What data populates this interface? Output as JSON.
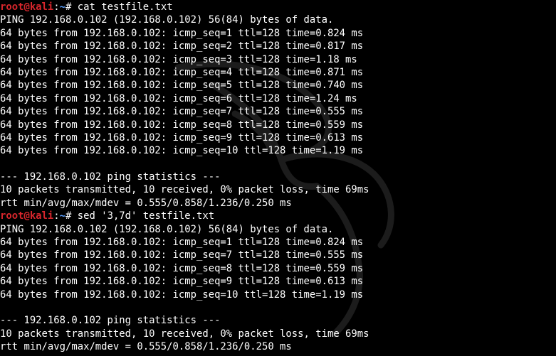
{
  "terminal": {
    "lines": [
      {
        "type": "prompt",
        "user": "root@kali",
        "sep": ":",
        "path": "~",
        "symbol": "# ",
        "command": "cat testfile.txt"
      },
      {
        "type": "text",
        "text": "PING 192.168.0.102 (192.168.0.102) 56(84) bytes of data."
      },
      {
        "type": "text",
        "text": "64 bytes from 192.168.0.102: icmp_seq=1 ttl=128 time=0.824 ms"
      },
      {
        "type": "text",
        "text": "64 bytes from 192.168.0.102: icmp_seq=2 ttl=128 time=0.817 ms"
      },
      {
        "type": "text",
        "text": "64 bytes from 192.168.0.102: icmp_seq=3 ttl=128 time=1.18 ms"
      },
      {
        "type": "text",
        "text": "64 bytes from 192.168.0.102: icmp_seq=4 ttl=128 time=0.871 ms"
      },
      {
        "type": "text",
        "text": "64 bytes from 192.168.0.102: icmp_seq=5 ttl=128 time=0.740 ms"
      },
      {
        "type": "text",
        "text": "64 bytes from 192.168.0.102: icmp_seq=6 ttl=128 time=1.24 ms"
      },
      {
        "type": "text",
        "text": "64 bytes from 192.168.0.102: icmp_seq=7 ttl=128 time=0.555 ms"
      },
      {
        "type": "text",
        "text": "64 bytes from 192.168.0.102: icmp_seq=8 ttl=128 time=0.559 ms"
      },
      {
        "type": "text",
        "text": "64 bytes from 192.168.0.102: icmp_seq=9 ttl=128 time=0.613 ms"
      },
      {
        "type": "text",
        "text": "64 bytes from 192.168.0.102: icmp_seq=10 ttl=128 time=1.19 ms"
      },
      {
        "type": "text",
        "text": ""
      },
      {
        "type": "text",
        "text": "--- 192.168.0.102 ping statistics ---"
      },
      {
        "type": "text",
        "text": "10 packets transmitted, 10 received, 0% packet loss, time 69ms"
      },
      {
        "type": "text",
        "text": "rtt min/avg/max/mdev = 0.555/0.858/1.236/0.250 ms"
      },
      {
        "type": "prompt",
        "user": "root@kali",
        "sep": ":",
        "path": "~",
        "symbol": "# ",
        "command": "sed '3,7d' testfile.txt"
      },
      {
        "type": "text",
        "text": "PING 192.168.0.102 (192.168.0.102) 56(84) bytes of data."
      },
      {
        "type": "text",
        "text": "64 bytes from 192.168.0.102: icmp_seq=1 ttl=128 time=0.824 ms"
      },
      {
        "type": "text",
        "text": "64 bytes from 192.168.0.102: icmp_seq=7 ttl=128 time=0.555 ms"
      },
      {
        "type": "text",
        "text": "64 bytes from 192.168.0.102: icmp_seq=8 ttl=128 time=0.559 ms"
      },
      {
        "type": "text",
        "text": "64 bytes from 192.168.0.102: icmp_seq=9 ttl=128 time=0.613 ms"
      },
      {
        "type": "text",
        "text": "64 bytes from 192.168.0.102: icmp_seq=10 ttl=128 time=1.19 ms"
      },
      {
        "type": "text",
        "text": ""
      },
      {
        "type": "text",
        "text": "--- 192.168.0.102 ping statistics ---"
      },
      {
        "type": "text",
        "text": "10 packets transmitted, 10 received, 0% packet loss, time 69ms"
      },
      {
        "type": "text",
        "text": "rtt min/avg/max/mdev = 0.555/0.858/1.236/0.250 ms"
      }
    ]
  },
  "colors": {
    "background": "#000000",
    "foreground": "#ffffff",
    "prompt_user": "#d7262c",
    "prompt_path": "#5aa0ff"
  },
  "background_icon": "kali-dragon-watermark-icon"
}
